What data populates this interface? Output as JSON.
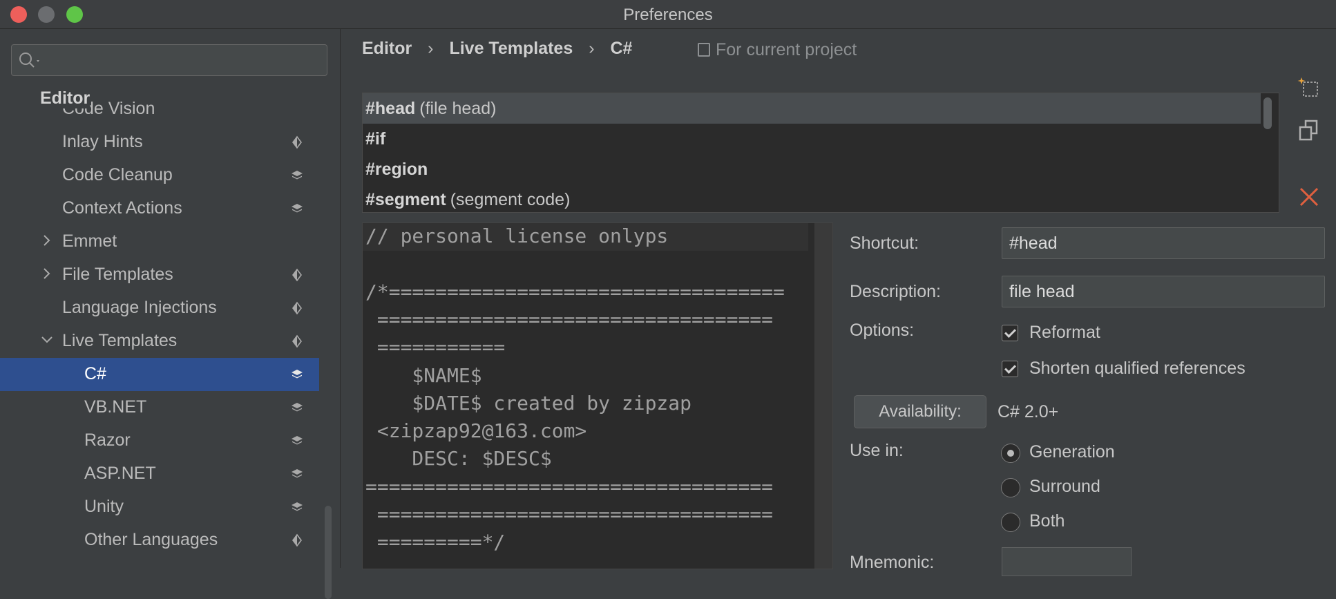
{
  "window": {
    "title": "Preferences"
  },
  "sidebar": {
    "search_placeholder": "",
    "header": "Editor",
    "items": [
      {
        "label": "Code Vision",
        "level": 1,
        "expandable": false,
        "expanded": false,
        "marker": "none"
      },
      {
        "label": "Inlay Hints",
        "level": 1,
        "expandable": false,
        "expanded": false,
        "marker": "diamond"
      },
      {
        "label": "Code Cleanup",
        "level": 1,
        "expandable": false,
        "expanded": false,
        "marker": "layers"
      },
      {
        "label": "Context Actions",
        "level": 1,
        "expandable": false,
        "expanded": false,
        "marker": "layers"
      },
      {
        "label": "Emmet",
        "level": 1,
        "expandable": true,
        "expanded": false,
        "marker": "none"
      },
      {
        "label": "File Templates",
        "level": 1,
        "expandable": true,
        "expanded": false,
        "marker": "diamond"
      },
      {
        "label": "Language Injections",
        "level": 1,
        "expandable": false,
        "expanded": false,
        "marker": "diamond"
      },
      {
        "label": "Live Templates",
        "level": 1,
        "expandable": true,
        "expanded": true,
        "marker": "diamond"
      },
      {
        "label": "C#",
        "level": 2,
        "expandable": false,
        "expanded": false,
        "marker": "layers",
        "selected": true
      },
      {
        "label": "VB.NET",
        "level": 2,
        "expandable": false,
        "expanded": false,
        "marker": "layers"
      },
      {
        "label": "Razor",
        "level": 2,
        "expandable": false,
        "expanded": false,
        "marker": "layers"
      },
      {
        "label": "ASP.NET",
        "level": 2,
        "expandable": false,
        "expanded": false,
        "marker": "layers"
      },
      {
        "label": "Unity",
        "level": 2,
        "expandable": false,
        "expanded": false,
        "marker": "layers"
      },
      {
        "label": "Other Languages",
        "level": 2,
        "expandable": false,
        "expanded": false,
        "marker": "diamond"
      }
    ]
  },
  "breadcrumb": {
    "items": [
      "Editor",
      "Live Templates",
      "C#"
    ],
    "separator": "›",
    "scope_label": "For current project"
  },
  "templates": [
    {
      "shortcut": "#head",
      "description": "(file head)",
      "selected": true
    },
    {
      "shortcut": "#if",
      "description": "",
      "selected": false
    },
    {
      "shortcut": "#region",
      "description": "",
      "selected": false
    },
    {
      "shortcut": "#segment",
      "description": "(segment code)",
      "selected": false
    }
  ],
  "toolbar_icons": [
    "new-template-icon",
    "duplicate-icon",
    "delete-icon"
  ],
  "editor": {
    "lines": [
      "// personal license onlyps",
      "",
      "/*==================================",
      " ==================================",
      " ===========",
      "    $NAME$",
      "    $DATE$ created by zipzap",
      " <zipzap92@163.com>",
      "    DESC: $DESC$",
      "===================================",
      " ==================================",
      " =========*/"
    ]
  },
  "form": {
    "shortcut_label": "Shortcut:",
    "shortcut_value": "#head",
    "description_label": "Description:",
    "description_value": "file head",
    "options_label": "Options:",
    "options": [
      {
        "label": "Reformat",
        "checked": true
      },
      {
        "label": "Shorten qualified references",
        "checked": true
      }
    ],
    "availability_button": "Availability:",
    "availability_value": "C# 2.0+",
    "use_in_label": "Use in:",
    "use_in": [
      {
        "label": "Generation",
        "selected": true
      },
      {
        "label": "Surround",
        "selected": false
      },
      {
        "label": "Both",
        "selected": false
      }
    ],
    "mnemonic_label": "Mnemonic:"
  }
}
